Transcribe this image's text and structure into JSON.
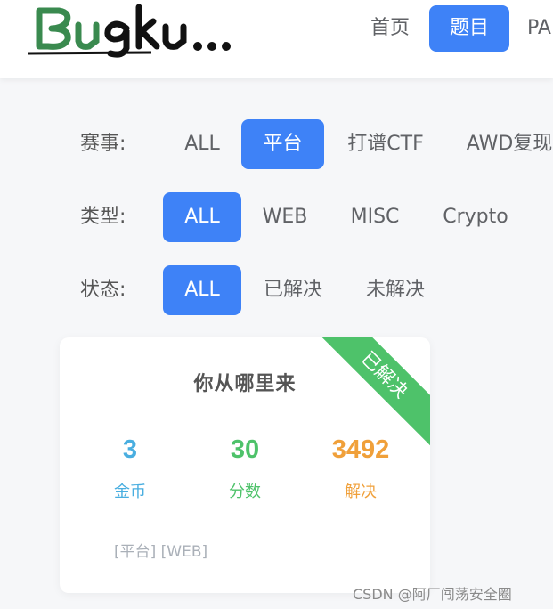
{
  "header": {
    "logo_text": "Bugku...",
    "nav": [
      {
        "label": "首页",
        "active": false
      },
      {
        "label": "题目",
        "active": true
      },
      {
        "label": "PA",
        "active": false
      }
    ]
  },
  "filters": {
    "event": {
      "label": "赛事:",
      "options": [
        "ALL",
        "平台",
        "打谱CTF",
        "AWD复现"
      ],
      "selected": "平台"
    },
    "type": {
      "label": "类型:",
      "options": [
        "ALL",
        "WEB",
        "MISC",
        "Crypto"
      ],
      "selected": "ALL"
    },
    "status": {
      "label": "状态:",
      "options": [
        "ALL",
        "已解决",
        "未解决"
      ],
      "selected": "ALL"
    }
  },
  "card": {
    "title": "你从哪里来",
    "ribbon": "已解决",
    "stats": [
      {
        "value": "3",
        "label": "金币",
        "color": "#49aee0"
      },
      {
        "value": "30",
        "label": "分数",
        "color": "#4ec26a"
      },
      {
        "value": "3492",
        "label": "解决",
        "color": "#f0a03a"
      }
    ],
    "tags": "[平台] [WEB]"
  },
  "watermark": "CSDN @阿厂闯荡安全圈",
  "colors": {
    "accent": "#3e82f7",
    "solved": "#4ec26a"
  }
}
